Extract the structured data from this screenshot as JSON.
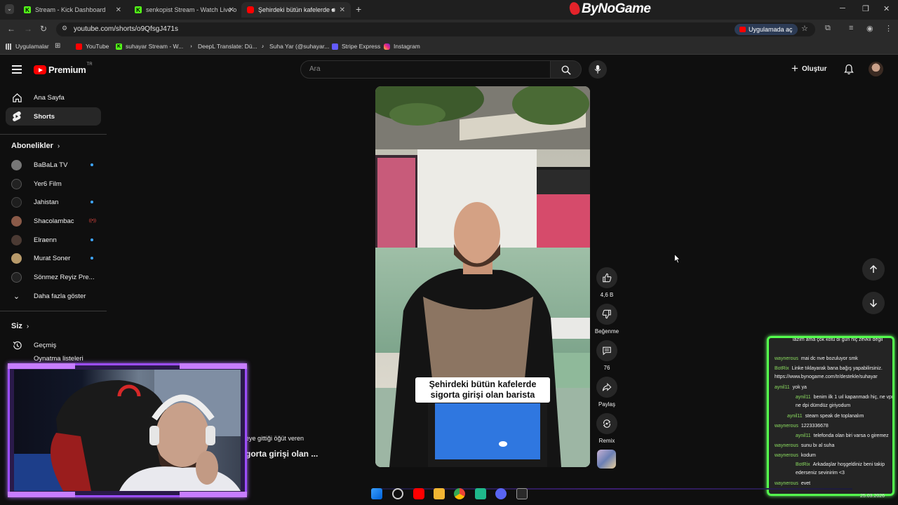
{
  "browser": {
    "tabs": [
      {
        "title": "Stream - Kick Dashboard",
        "favicon": "kick-icon"
      },
      {
        "title": "senkopist Stream - Watch Live o",
        "favicon": "kick-icon"
      },
      {
        "title": "Şehirdeki bütün kafelerde s",
        "favicon": "youtube-icon",
        "active": true
      }
    ],
    "overlay_brand": "ByNoGame",
    "url": "youtube.com/shorts/o9QfsgJ471s",
    "open_in_app": "Uygulamada aç",
    "bookmarks": [
      {
        "label": "Uygulamalar",
        "icon": "apps-icon"
      },
      {
        "label": "YouTube",
        "icon": "youtube-icon"
      },
      {
        "label": "suhayar Stream - W...",
        "icon": "kick-icon"
      },
      {
        "label": "DeepL Translate: Dü...",
        "icon": "deepl-icon"
      },
      {
        "label": "Suha Yar (@suhayar...",
        "icon": "tiktok-icon"
      },
      {
        "label": "Stripe Express",
        "icon": "stripe-icon"
      },
      {
        "label": "Instagram",
        "icon": "instagram-icon"
      }
    ]
  },
  "youtube": {
    "logo_text": "Premium",
    "logo_region": "TR",
    "search_placeholder": "Ara",
    "create_label": "Oluştur",
    "sidebar": {
      "home": "Ana Sayfa",
      "shorts": "Shorts",
      "subs_title": "Abonelikler",
      "subscriptions": [
        {
          "name": "BaBaLa TV",
          "indicator": "dot"
        },
        {
          "name": "Yer6 Film",
          "indicator": ""
        },
        {
          "name": "Jahistan",
          "indicator": "dot"
        },
        {
          "name": "Shacolambac",
          "indicator": "live"
        },
        {
          "name": "Elraenn",
          "indicator": "dot"
        },
        {
          "name": "Murat Soner",
          "indicator": "dot"
        },
        {
          "name": "Sönmez Reyiz Pre...",
          "indicator": ""
        }
      ],
      "show_more": "Daha fazla göster",
      "you_title": "Siz",
      "history": "Geçmiş",
      "playlists": "Oynatma listeleri"
    },
    "video": {
      "caption": "Şehirdeki bütün kafelerde sigorta girişi olan barista",
      "like_count": "4,6 B",
      "dislike_label": "Beğenme",
      "comment_count": "76",
      "share_label": "Paylaş",
      "remix_label": "Remix"
    },
    "behind_overlay": {
      "line1": "eye gittiği öğüt veren",
      "line2": "gorta girişi olan ..."
    }
  },
  "chat": {
    "messages": [
      {
        "user": "",
        "text": "lazım ama çok kötü bi gün hiç zevkli değil"
      },
      {
        "user": "waynerous",
        "text": "mai dc nve bozuluyor smk"
      },
      {
        "user": "BotRix",
        "text": "Linke tıklayarak bana bağış yapabilirsiniz. https://www.bynogame.com/tr/destekle/suhayar"
      },
      {
        "user": "aynil11",
        "text": "yok ya"
      },
      {
        "user": "aynil11",
        "text": "benim ilk 1 uıl kapanmadı hiç, ne vpn ne dpi dümdüz giriyodum"
      },
      {
        "user": "aynil11",
        "text": "steam speak de toplanalım"
      },
      {
        "user": "waynerous",
        "text": "1223336678"
      },
      {
        "user": "aynil11",
        "text": "telefonda olan biri varsa o giremez"
      },
      {
        "user": "waynerous",
        "text": "sunu bı al suha"
      },
      {
        "user": "waynerous",
        "text": "kodum"
      },
      {
        "user": "BotRix",
        "text": "Arkadaşlar hoşgeldiniz beni takip ederseniz sevinirim <3"
      },
      {
        "user": "waynerous",
        "text": "evet"
      }
    ]
  },
  "taskbar": {
    "date": "25.03.2026"
  },
  "colors": {
    "yt_red": "#ff0000",
    "chat_border": "#54ff4d",
    "webcam_border": "#9c4dff",
    "chat_username": "#8adb5f"
  }
}
